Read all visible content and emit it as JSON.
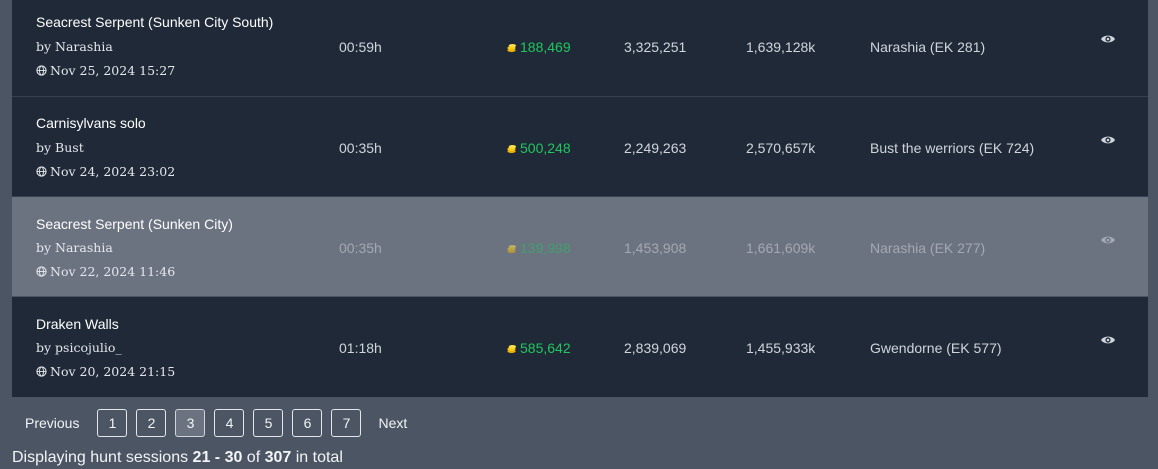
{
  "rows": [
    {
      "title": "Seacrest Serpent (Sunken City South)",
      "author": "by Narashia",
      "date": "Nov 25, 2024 15:27",
      "duration": "00:59h",
      "profit": "188,469",
      "xp": "3,325,251",
      "damage": "1,639,128k",
      "character": "Narashia (EK 281)"
    },
    {
      "title": "Carnisylvans solo",
      "author": "by Bust",
      "date": "Nov 24, 2024 23:02",
      "duration": "00:35h",
      "profit": "500,248",
      "xp": "2,249,263",
      "damage": "2,570,657k",
      "character": "Bust the werriors (EK 724)"
    },
    {
      "title": "Seacrest Serpent (Sunken City)",
      "author": "by Narashia",
      "date": "Nov 22, 2024 11:46",
      "duration": "00:35h",
      "profit": "139,998",
      "xp": "1,453,908",
      "damage": "1,661,609k",
      "character": "Narashia (EK 277)"
    },
    {
      "title": "Draken Walls",
      "author": "by psicojulio_",
      "date": "Nov 20, 2024 21:15",
      "duration": "01:18h",
      "profit": "585,642",
      "xp": "2,839,069",
      "damage": "1,455,933k",
      "character": "Gwendorne (EK 577)"
    }
  ],
  "pagination": {
    "previous": "Previous",
    "next": "Next",
    "pages": [
      "1",
      "2",
      "3",
      "4",
      "5",
      "6",
      "7"
    ],
    "current": "3"
  },
  "summary": {
    "prefix": "Displaying hunt sessions ",
    "range": "21 - 30",
    "of": " of ",
    "total": "307",
    "suffix": " in total"
  },
  "icons": {
    "date": "globe-icon",
    "profit": "gold-coins-icon",
    "view": "eye-icon"
  },
  "colors": {
    "profit": "#22c55e",
    "row_bg": "#1f2937",
    "page_bg": "#4b5563"
  }
}
